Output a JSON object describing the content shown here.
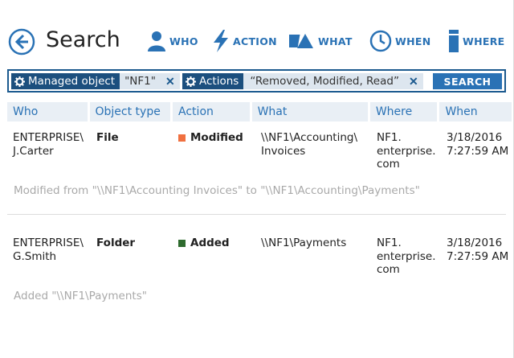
{
  "header": {
    "title": "Search",
    "nav": [
      {
        "label": "WHO",
        "icon": "person-icon"
      },
      {
        "label": "ACTION",
        "icon": "lightning-icon"
      },
      {
        "label": "WHAT",
        "icon": "shapes-icon"
      },
      {
        "label": "WHEN",
        "icon": "clock-icon"
      },
      {
        "label": "WHERE",
        "icon": "server-icon"
      }
    ]
  },
  "search": {
    "chips": [
      {
        "name": "Managed object",
        "value": "\"NF1\""
      },
      {
        "name": "Actions",
        "value": "“Removed, Modified, Read”"
      }
    ],
    "button_label": "SEARCH"
  },
  "table": {
    "columns": [
      "Who",
      "Object type",
      "Action",
      "What",
      "Where",
      "When"
    ],
    "rows": [
      {
        "who": "ENTERPRISE\\ J.Carter",
        "object_type": "File",
        "action": "Modified",
        "action_color": "#f07040",
        "what": "\\\\NF1\\Accounting\\ Invoices",
        "where": "NF1. enterprise. com",
        "when": "3/18/2016 7:27:59 AM",
        "detail": "Modified from \"\\\\NF1\\Accounting Invoices\" to \"\\\\NF1\\Accounting\\Payments\""
      },
      {
        "who": "ENTERPRISE\\ G.Smith",
        "object_type": "Folder",
        "action": "Added",
        "action_color": "#2e6b2e",
        "what": "\\\\NF1\\Payments",
        "where": "NF1. enterprise. com",
        "when": "3/18/2016 7:27:59 AM",
        "detail": "Added \"\\\\NF1\\Payments\""
      }
    ]
  },
  "colors": {
    "accent": "#2a72b5",
    "dark_accent": "#1c4f7e",
    "header_bg": "#e9eff5",
    "detail_text": "#a9a9a9"
  }
}
